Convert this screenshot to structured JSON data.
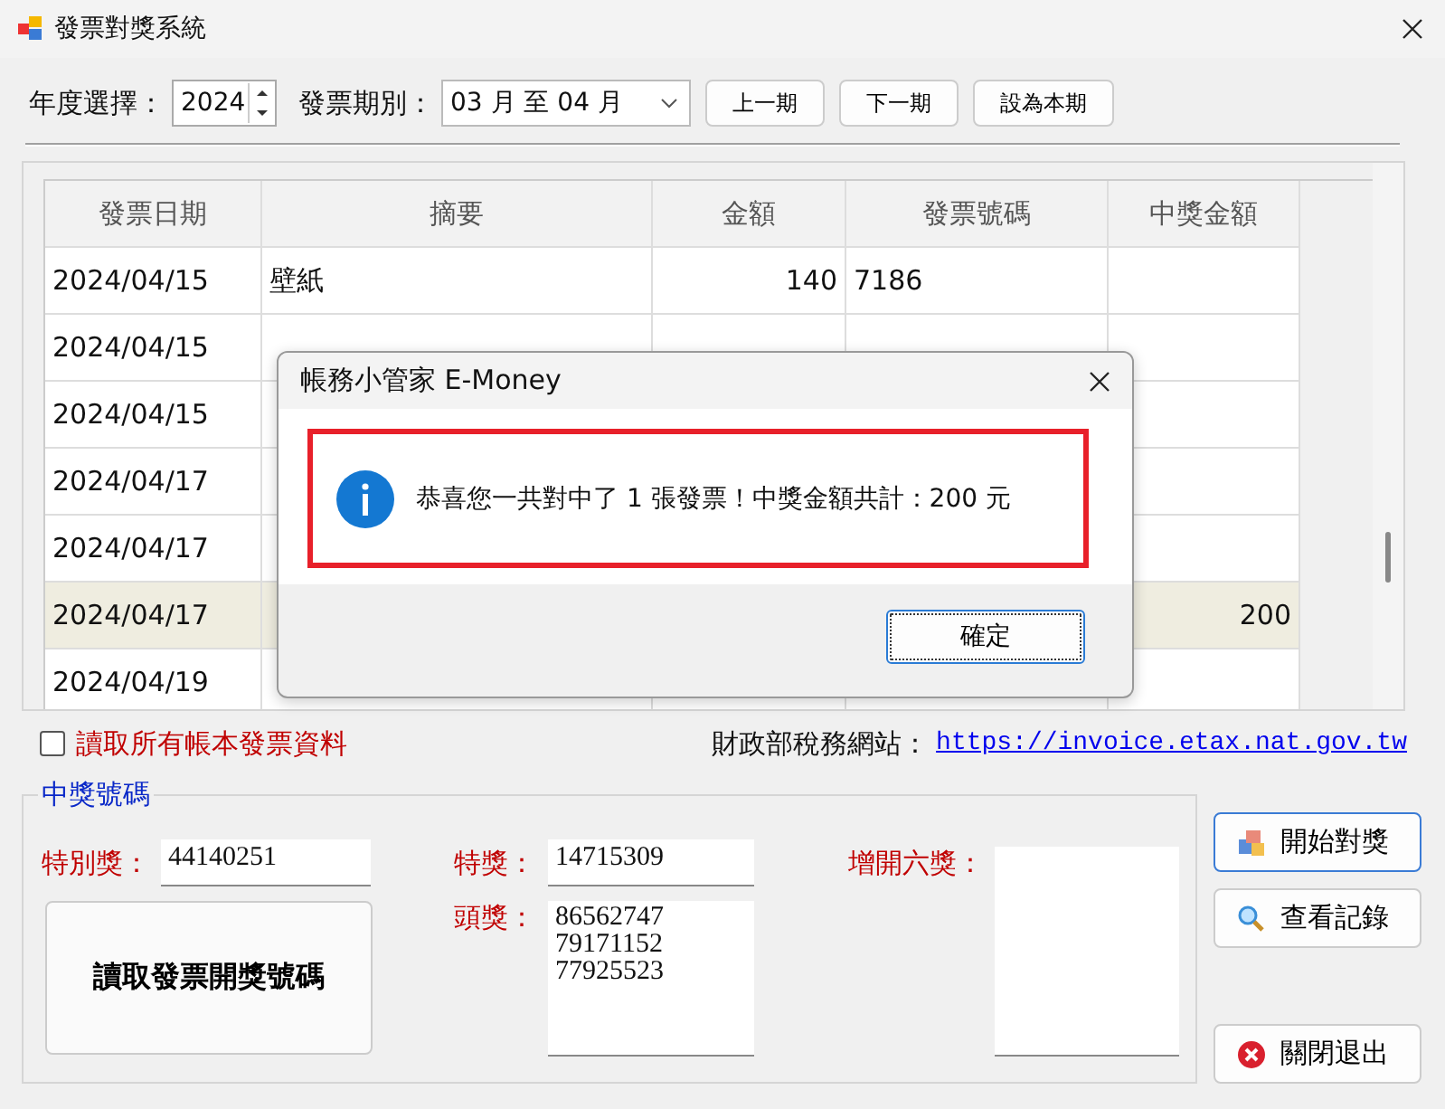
{
  "window": {
    "title": "發票對獎系統"
  },
  "toolbar": {
    "year_label": "年度選擇：",
    "year_value": "2024",
    "period_label": "發票期別：",
    "period_value": "03 月 至 04 月",
    "buttons": [
      "上一期",
      "下一期",
      "設為本期"
    ]
  },
  "table": {
    "columns": [
      "發票日期",
      "摘要",
      "金額",
      "發票號碼",
      "中獎金額"
    ],
    "rows": [
      {
        "date": "2024/04/15",
        "summary": "壁紙",
        "amount": "140",
        "invoice": "7186",
        "selected": false
      },
      {
        "date": "2024/04/15",
        "selected": false
      },
      {
        "date": "2024/04/15",
        "selected": false
      },
      {
        "date": "2024/04/17",
        "selected": false
      },
      {
        "date": "2024/04/17",
        "selected": false
      },
      {
        "date": "2024/04/17",
        "prize": "200",
        "selected": true
      },
      {
        "date": "2024/04/19",
        "selected": false
      }
    ]
  },
  "options": {
    "read_all": {
      "label": "讀取所有帳本發票資料",
      "checked": false
    },
    "site_label": "財政部稅務網站：",
    "site_link": "https://invoice.etax.nat.gov.tw"
  },
  "winning_numbers": {
    "title": "中獎號碼",
    "special": {
      "label": "特別獎：",
      "value": "44140251"
    },
    "grand": {
      "label": "特獎：",
      "value": "14715309"
    },
    "first": {
      "label": "頭獎：",
      "values": [
        "86562747",
        "79171152",
        "77925523"
      ]
    },
    "sixth": {
      "label": "增開六獎："
    },
    "fetch_button": "讀取發票開獎號碼"
  },
  "actions": [
    {
      "label": "開始對獎",
      "kind": "compare"
    },
    {
      "label": "查看記錄",
      "kind": "search"
    },
    {
      "label": "關閉退出",
      "kind": "close"
    }
  ],
  "dialog": {
    "title": "帳務小管家 E-Money",
    "message": "恭喜您一共對中了 1 張發票！中獎金額共計：200 元",
    "ok_button": "確定"
  }
}
